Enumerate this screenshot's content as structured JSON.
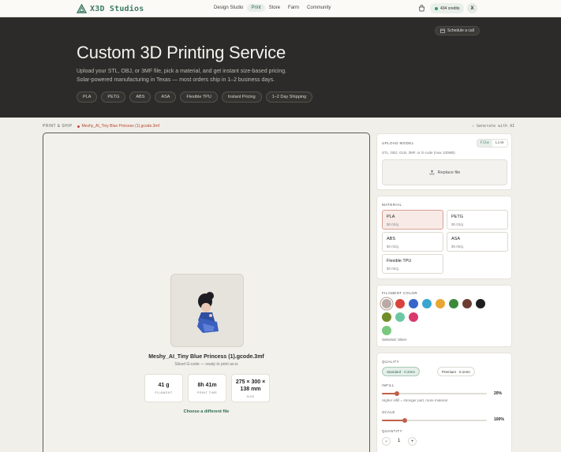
{
  "nav": {
    "brand": "X3D Studios",
    "links": [
      "Design Studio",
      "Print",
      "Store",
      "Farm",
      "Community"
    ],
    "active": "Print",
    "credits": "434 credits",
    "avatar": "X"
  },
  "hero": {
    "schedule": "Schedule a call",
    "title": "Custom 3D Printing Service",
    "subtitle_line1": "Upload your STL, OBJ, or 3MF file, pick a material, and get instant size-based pricing.",
    "subtitle_line2": "Solar-powered manufacturing in Texas — most orders ship in 1–2 business days.",
    "chips": [
      "PLA",
      "PETG",
      "ABS",
      "ASA",
      "Flexible TPU",
      "Instant Pricing",
      "1–2 Day Shipping"
    ]
  },
  "breadcrumb": {
    "section": "PRINT & SHIP",
    "file": "Meshy_AI_Tiny Blue Princess (1).gcode.3mf",
    "generate": "Generate with AI"
  },
  "viewer": {
    "model_name": "Meshy_AI_Tiny Blue Princess (1).gcode.3mf",
    "model_sub": "Sliced G-code — ready to print as-is",
    "stats": [
      {
        "value": "41 g",
        "label": "FILAMENT"
      },
      {
        "value": "8h 41m",
        "label": "PRINT TIME"
      },
      {
        "value": "275 × 300 ×",
        "value2": "138 mm",
        "label": "SIZE"
      }
    ],
    "choose": "Choose a different file"
  },
  "upload": {
    "title": "UPLOAD MODEL",
    "tab_file": "File",
    "tab_link": "Link",
    "hint": "STL, OBJ, GLB, 3MF, or G-code (max 100MB)",
    "replace": "Replace file"
  },
  "material": {
    "title": "MATERIAL",
    "options": [
      {
        "name": "PLA",
        "price": "$0.02/g"
      },
      {
        "name": "PETG",
        "price": "$0.03/g"
      },
      {
        "name": "ABS",
        "price": "$0.03/g"
      },
      {
        "name": "ASA",
        "price": "$0.05/g"
      },
      {
        "name": "Flexible TPU",
        "price": "$0.05/g"
      }
    ],
    "selected": "PLA"
  },
  "color": {
    "title": "FILAMENT COLOR",
    "swatches": [
      "#b9aaa6",
      "#d9433b",
      "#3566c9",
      "#3aa6d0",
      "#e8a733",
      "#3a8a3a",
      "#6b3c31",
      "#1e1e1e",
      "#f1f0ee",
      "#6f8e2b",
      "#6cc7a4",
      "#d8386c",
      "#7ac77e"
    ],
    "selected_label": "Selected: Silver"
  },
  "quality": {
    "title": "QUALITY",
    "standard": "Standard · 0.2mm",
    "standard_tag": "0.2mm",
    "premium": "Premium · 0.1mm",
    "premium_tag": "0.1mm",
    "infill_label": "INFILL",
    "infill_value": "20%",
    "infill_pct": 0.14,
    "infill_hint": "Higher infill = stronger part, more material",
    "scale_label": "SCALE",
    "scale_value": "100%",
    "scale_pct": 0.22,
    "quantity_label": "QUANTITY",
    "quantity": "1",
    "minus": "−",
    "plus": "+"
  }
}
